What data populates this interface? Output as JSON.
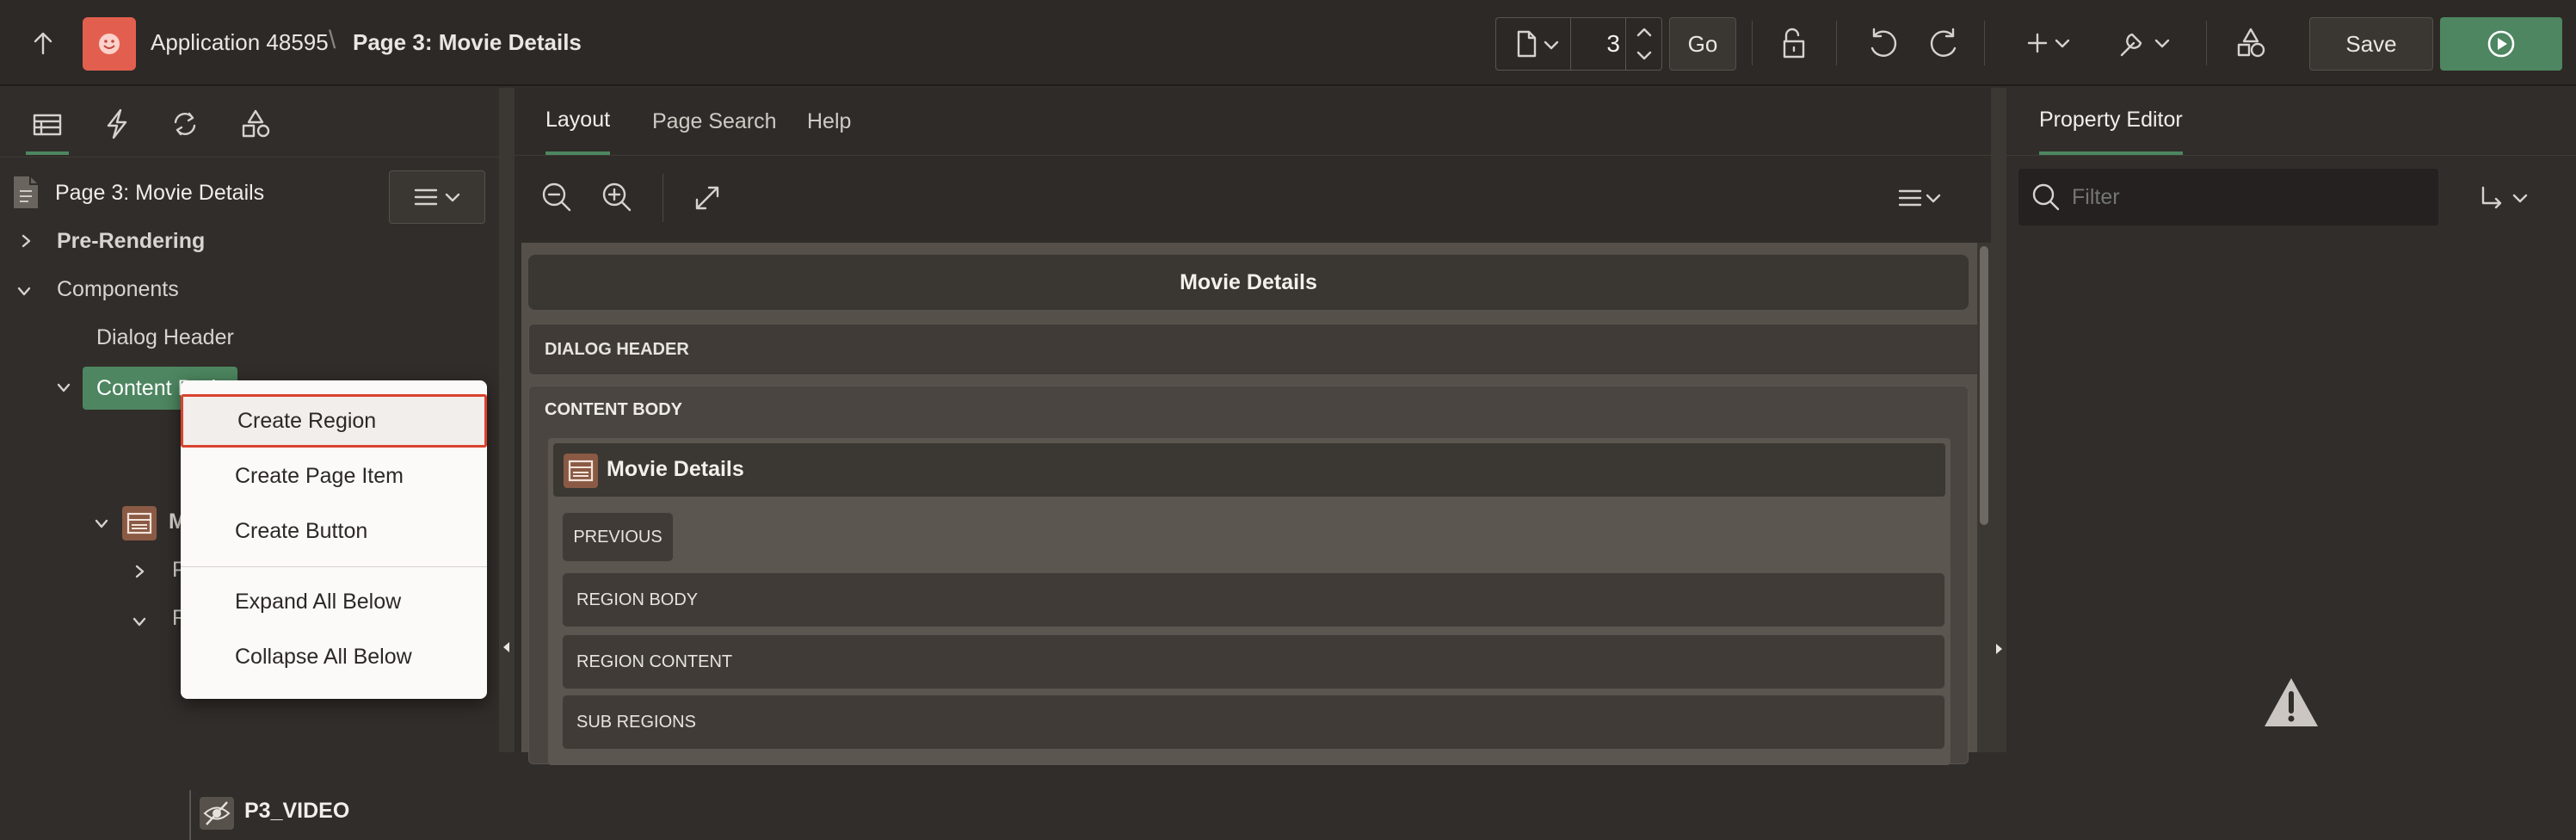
{
  "header": {
    "app_name": "Application 48595",
    "separator": "\\",
    "page_name": "Page 3: Movie Details",
    "page_number_value": "3",
    "go_label": "Go",
    "save_label": "Save"
  },
  "left_panel": {
    "tabs": [
      "rendering-tab",
      "dynamic-actions-tab",
      "processing-tab",
      "shared-components-tab"
    ],
    "page_title": "Page 3: Movie Details",
    "tree": {
      "pre_rendering": "Pre-Rendering",
      "components": "Components",
      "dialog_header": "Dialog Header",
      "content_body": "Content Body",
      "node_m": "M",
      "node_p": "P",
      "node_r": "R",
      "p3_video": "P3_VIDEO"
    }
  },
  "context_menu": {
    "items": [
      "Create Region",
      "Create Page Item",
      "Create Button",
      "Expand All Below",
      "Collapse All Below"
    ]
  },
  "center": {
    "tabs": [
      "Layout",
      "Page Search",
      "Help"
    ],
    "active_tab": "Layout",
    "dialog_title": "Movie Details",
    "dialog_header": "DIALOG HEADER",
    "content_body": "CONTENT BODY",
    "region_title": "Movie Details",
    "previous": "PREVIOUS",
    "region_body": "REGION BODY",
    "region_content": "REGION CONTENT",
    "sub_regions": "SUB REGIONS"
  },
  "right_panel": {
    "title": "Property Editor",
    "filter_placeholder": "Filter"
  },
  "colors": {
    "accent_green": "#4d8660",
    "highlight_red": "#d9432f",
    "app_icon": "#e25f4f"
  }
}
